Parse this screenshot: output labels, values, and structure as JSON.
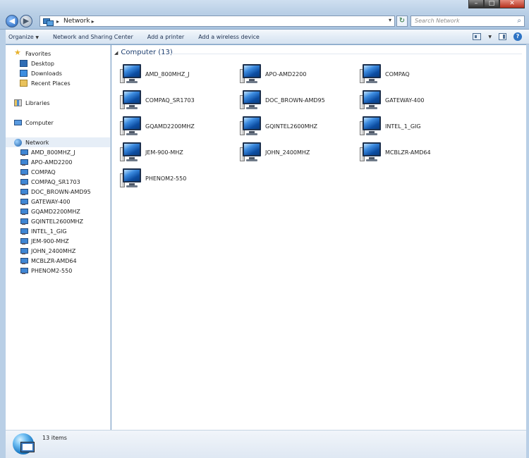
{
  "window": {
    "caption_buttons": [
      "minimize",
      "maximize",
      "close"
    ]
  },
  "address_bar": {
    "path": [
      "Network"
    ],
    "separator": "▸",
    "refresh_symbol": "↻"
  },
  "search": {
    "placeholder": "Search Network"
  },
  "toolbar": {
    "organize": "Organize",
    "network_sharing": "Network and Sharing Center",
    "add_printer": "Add a printer",
    "add_wireless": "Add a wireless device",
    "help": "?"
  },
  "nav": {
    "favorites": {
      "label": "Favorites",
      "items": [
        "Desktop",
        "Downloads",
        "Recent Places"
      ]
    },
    "libraries": "Libraries",
    "computer": "Computer",
    "network": {
      "label": "Network",
      "items": [
        "AMD_800MHZ_J",
        "APO-AMD2200",
        "COMPAQ",
        "COMPAQ_SR1703",
        "DOC_BROWN-AMD95",
        "GATEWAY-400",
        "GQAMD2200MHZ",
        "GQINTEL2600MHZ",
        "INTEL_1_GIG",
        "JEM-900-MHZ",
        "JOHN_2400MHZ",
        "MCBLZR-AMD64",
        "PHENOM2-550"
      ]
    }
  },
  "content": {
    "group_header": "Computer (13)",
    "computers": [
      "AMD_800MHZ_J",
      "APO-AMD2200",
      "COMPAQ",
      "COMPAQ_SR1703",
      "DOC_BROWN-AMD95",
      "GATEWAY-400",
      "GQAMD2200MHZ",
      "GQINTEL2600MHZ",
      "INTEL_1_GIG",
      "JEM-900-MHZ",
      "JOHN_2400MHZ",
      "MCBLZR-AMD64",
      "PHENOM2-550"
    ]
  },
  "statusbar": {
    "text": "13 items"
  }
}
